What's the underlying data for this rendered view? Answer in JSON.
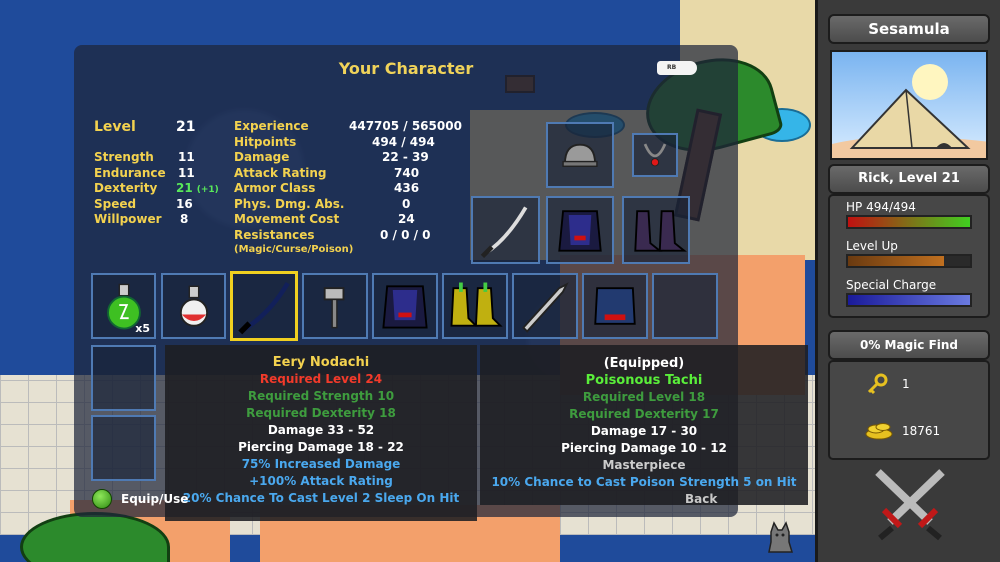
{
  "screen": {
    "title": "Your Character"
  },
  "level": {
    "label": "Level",
    "value": "21"
  },
  "attributes": [
    {
      "label": "Strength",
      "value": "11",
      "bonus": ""
    },
    {
      "label": "Endurance",
      "value": "11",
      "bonus": ""
    },
    {
      "label": "Dexterity",
      "value": "21",
      "bonus": "(+1)"
    },
    {
      "label": "Speed",
      "value": "16",
      "bonus": ""
    },
    {
      "label": "Willpower",
      "value": "8",
      "bonus": ""
    }
  ],
  "stats": [
    {
      "label": "Experience",
      "value": "447705 / 565000"
    },
    {
      "label": "Hitpoints",
      "value": "494 / 494"
    },
    {
      "label": "Damage",
      "value": "22 - 39"
    },
    {
      "label": "Attack Rating",
      "value": "740"
    },
    {
      "label": "Armor Class",
      "value": "436"
    },
    {
      "label": "Phys. Dmg. Abs.",
      "value": "0"
    },
    {
      "label": "Movement Cost",
      "value": "24"
    },
    {
      "label": "Resistances",
      "value": "0 / 0 / 0"
    }
  ],
  "resist_sub": "(Magic/Curse/Poison)",
  "inventory": {
    "potion_green_qty": "x5",
    "key_marker": "RB"
  },
  "tooltip_selected": {
    "name": "Eery Nodachi",
    "req_level": "Required Level 24",
    "req_str": "Required Strength 10",
    "req_dex": "Required Dexterity 18",
    "damage": "Damage 33 - 52",
    "piercing": "Piercing Damage 18 - 22",
    "mod1": "75% Increased Damage",
    "mod2": "+100% Attack Rating",
    "mod3": "20% Chance To Cast Level 2 Sleep On Hit"
  },
  "tooltip_equipped": {
    "header": "(Equipped)",
    "name": "Poisonous Tachi",
    "req_level": "Required Level 18",
    "req_dex": "Required Dexterity 17",
    "damage": "Damage 17 - 30",
    "piercing": "Piercing Damage 10 - 12",
    "quality": "Masterpiece",
    "mod1": "10% Chance to Cast Poison Strength 5 on Hit"
  },
  "hints": {
    "equip": "Equip/Use",
    "back": "Back"
  },
  "sidebar": {
    "player_name": "Sesamula",
    "char_line": "Rick, Level 21",
    "hp_label": "HP 494/494",
    "hp_fraction": 1.0,
    "levelup_label": "Level Up",
    "levelup_fraction": 0.79,
    "special_label": "Special Charge",
    "special_fraction": 1.0,
    "magic_find": "0% Magic Find",
    "keys": "1",
    "gold": "18761"
  }
}
